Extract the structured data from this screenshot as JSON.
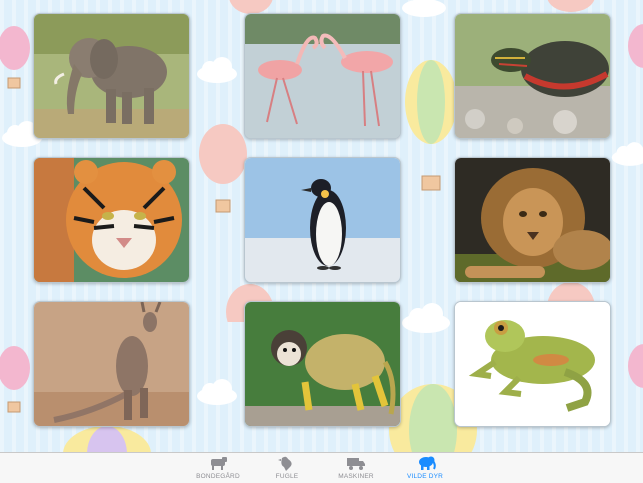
{
  "colors": {
    "background": "#dff0fb",
    "tab_active": "#1a8cff",
    "tab_inactive": "#8e8e93"
  },
  "tiles": [
    {
      "animal": "elephant",
      "icon": "elephant-photo"
    },
    {
      "animal": "flamingos",
      "icon": "flamingo-photo"
    },
    {
      "animal": "turtle",
      "icon": "turtle-photo"
    },
    {
      "animal": "tiger",
      "icon": "tiger-photo"
    },
    {
      "animal": "penguin",
      "icon": "penguin-photo"
    },
    {
      "animal": "lion",
      "icon": "lion-photo"
    },
    {
      "animal": "kangaroo",
      "icon": "kangaroo-photo"
    },
    {
      "animal": "monkey",
      "icon": "monkey-photo"
    },
    {
      "animal": "frog",
      "icon": "frog-photo"
    }
  ],
  "tabbar": {
    "tabs": [
      {
        "label": "BONDEGÅRD",
        "icon": "cow-icon",
        "active": false
      },
      {
        "label": "FUGLE",
        "icon": "bird-icon",
        "active": false
      },
      {
        "label": "MASKINER",
        "icon": "truck-icon",
        "active": false
      },
      {
        "label": "VILDE DYR",
        "icon": "elephant-icon",
        "active": true
      }
    ]
  }
}
